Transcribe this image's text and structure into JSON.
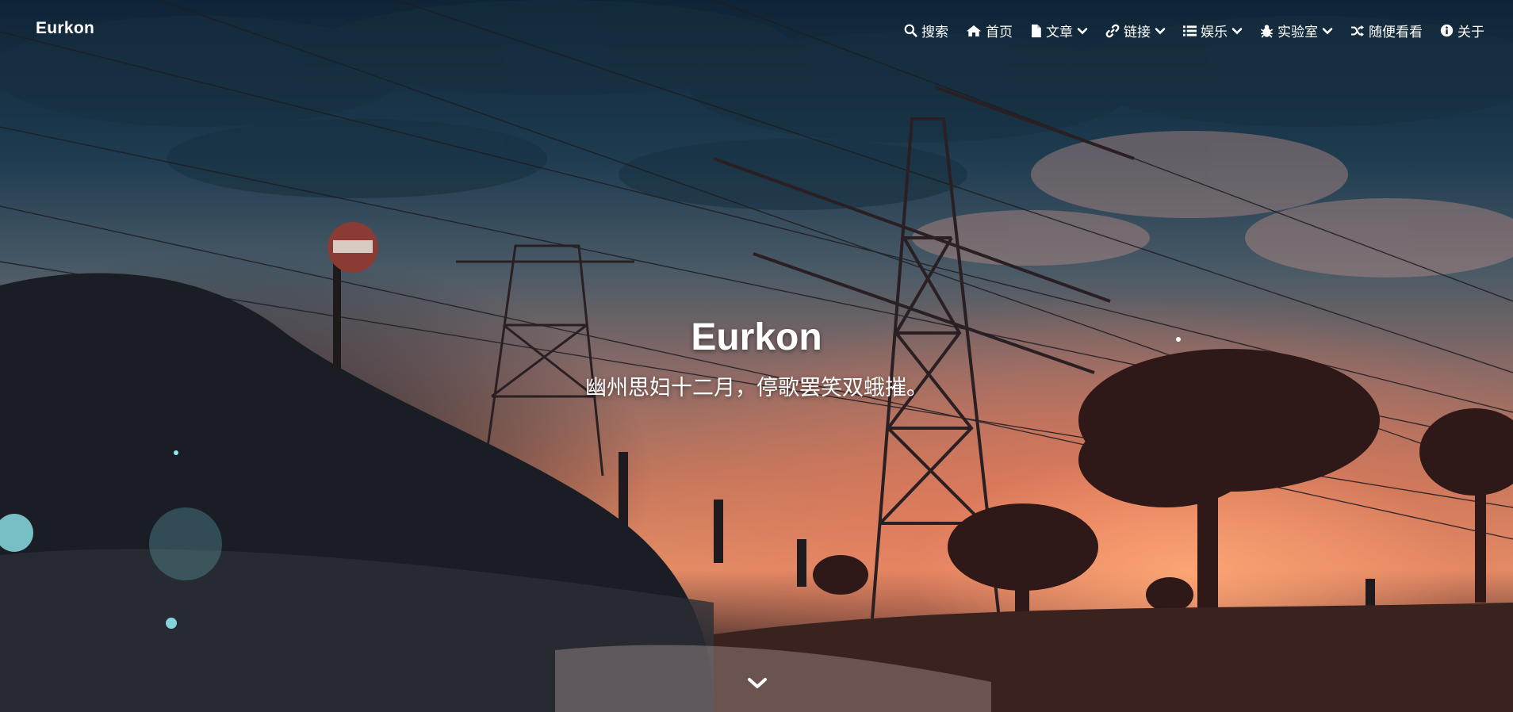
{
  "site": {
    "brand": "Eurkon",
    "title": "Eurkon",
    "subtitle": "幽州思妇十二月，停歌罢笑双蛾摧。"
  },
  "nav": {
    "items": [
      {
        "label": "搜索",
        "icon": "search-icon"
      },
      {
        "label": "首页",
        "icon": "home-icon"
      },
      {
        "label": "文章",
        "icon": "file-icon",
        "dropdown": true
      },
      {
        "label": "链接",
        "icon": "link-icon",
        "dropdown": true
      },
      {
        "label": "娱乐",
        "icon": "list-icon",
        "dropdown": true
      },
      {
        "label": "实验室",
        "icon": "bug-icon",
        "dropdown": true
      },
      {
        "label": "随便看看",
        "icon": "shuffle-icon"
      },
      {
        "label": "关于",
        "icon": "info-icon"
      }
    ]
  },
  "hero": {
    "background": "anime sunset scene with power pylons and trees",
    "scroll_icon": "chevron-down-icon"
  },
  "colors": {
    "text": "#ffffff",
    "sky_top": "#0f2436",
    "sunset": "#e48c66"
  }
}
